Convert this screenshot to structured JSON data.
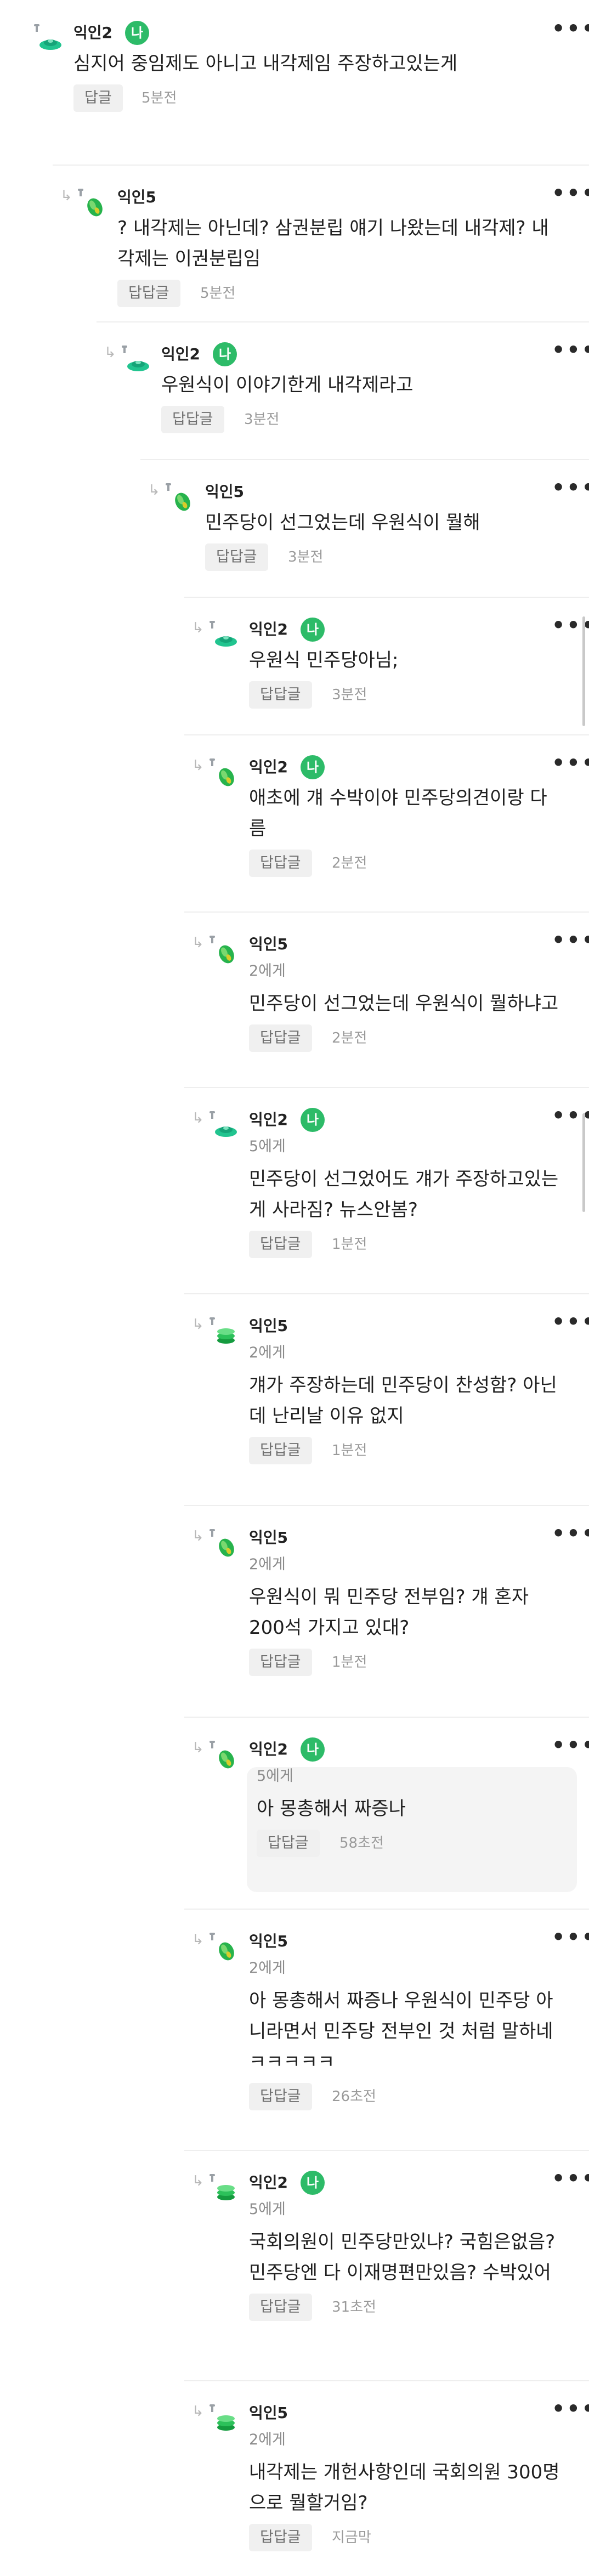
{
  "accent_color": "#2dbb68",
  "comments": [
    {
      "author": "익인2",
      "badge": "나",
      "text_lines": [
        "심지어 중임제도 아니고 내각제임 주장하고있는게"
      ],
      "reply_label": "답글",
      "time": "5분전",
      "avatar": "teal-dish-icon",
      "reply_arrow": false,
      "menu": "•••"
    },
    {
      "author": "익인5",
      "text_lines": [
        "? 내각제는 아닌데? 삼권분립 얘기 나왔는데 내각제? 내",
        "각제는 이권분립임"
      ],
      "reply_label": "답답글",
      "time": "5분전",
      "avatar": "green-leaf-icon",
      "reply_arrow": true,
      "menu": "•••"
    },
    {
      "author": "익인2",
      "badge": "나",
      "text_lines": [
        "우원식이 이야기한게 내각제라고"
      ],
      "reply_label": "답답글",
      "time": "3분전",
      "avatar": "teal-dish-icon",
      "reply_arrow": true,
      "menu": "•••"
    },
    {
      "author": "익인5",
      "text_lines": [
        "민주당이 선그었는데 우원식이 뭘해"
      ],
      "reply_label": "답답글",
      "time": "3분전",
      "avatar": "green-leaf-icon",
      "reply_arrow": true,
      "menu": "•••"
    },
    {
      "author": "익인2",
      "badge": "나",
      "text_lines": [
        "우원식 민주당아님;"
      ],
      "reply_label": "답답글",
      "time": "3분전",
      "avatar": "teal-dish-icon",
      "reply_arrow": true,
      "menu": "•••"
    },
    {
      "author": "익인2",
      "badge": "나",
      "text_lines": [
        "애초에 걔 수박이야 민주당의견이랑 다",
        "름"
      ],
      "reply_label": "답답글",
      "time": "2분전",
      "avatar": "green-leaf-icon",
      "reply_arrow": true,
      "menu": "•••"
    },
    {
      "author": "익인5",
      "target": "2에게",
      "text_lines": [
        "민주당이 선그었는데 우원식이 뭘하냐고"
      ],
      "reply_label": "답답글",
      "time": "2분전",
      "avatar": "green-leaf-icon",
      "reply_arrow": true,
      "menu": "•••"
    },
    {
      "author": "익인2",
      "badge": "나",
      "target": "5에게",
      "text_lines": [
        "민주당이 선그었어도 걔가 주장하고있는",
        "게 사라짐? 뉴스안봄?"
      ],
      "reply_label": "답답글",
      "time": "1분전",
      "avatar": "teal-dish-icon",
      "reply_arrow": true,
      "menu": "•••"
    },
    {
      "author": "익인5",
      "target": "2에게",
      "text_lines": [
        "걔가 주장하는데 민주당이 찬성함? 아닌",
        "데 난리날 이유 없지"
      ],
      "reply_label": "답답글",
      "time": "1분전",
      "avatar": "green-stack-icon",
      "reply_arrow": true,
      "menu": "•••"
    },
    {
      "author": "익인5",
      "target": "2에게",
      "text_lines": [
        "우원식이 뭐 민주당 전부임? 걔 혼자",
        "200석 가지고 있대?"
      ],
      "reply_label": "답답글",
      "time": "1분전",
      "avatar": "green-leaf-icon",
      "reply_arrow": true,
      "menu": "•••"
    },
    {
      "author": "익인2",
      "badge": "나",
      "target": "5에게",
      "text_lines": [
        "아 몽총해서 짜증나"
      ],
      "reply_label": "답답글",
      "time": "58초전",
      "avatar": "green-leaf-icon",
      "reply_arrow": true,
      "menu": "•••",
      "highlighted": true
    },
    {
      "author": "익인5",
      "target": "2에게",
      "text_lines": [
        "아 몽총해서 짜증나 우원식이 민주당 아",
        "니라면서 민주당 전부인 것 처럼 말하네",
        "ㅋㅋㅋㅋㅋ"
      ],
      "reply_label": "답답글",
      "time": "26초전",
      "avatar": "green-leaf-icon",
      "reply_arrow": true,
      "menu": "•••"
    },
    {
      "author": "익인2",
      "badge": "나",
      "target": "5에게",
      "text_lines": [
        "국회의원이 민주당만있냐? 국힘은없음?",
        "민주당엔 다 이재명편만있음? 수박있어"
      ],
      "reply_label": "답답글",
      "time": "31초전",
      "avatar": "green-stack-icon",
      "reply_arrow": true,
      "menu": "•••"
    },
    {
      "author": "익인5",
      "target": "2에게",
      "text_lines": [
        "내각제는 개헌사항인데 국회의원 300명",
        "으로 뭘할거임?"
      ],
      "reply_label": "답답글",
      "time": "지금막",
      "avatar": "green-stack-icon",
      "reply_arrow": true,
      "menu": "•••"
    }
  ]
}
